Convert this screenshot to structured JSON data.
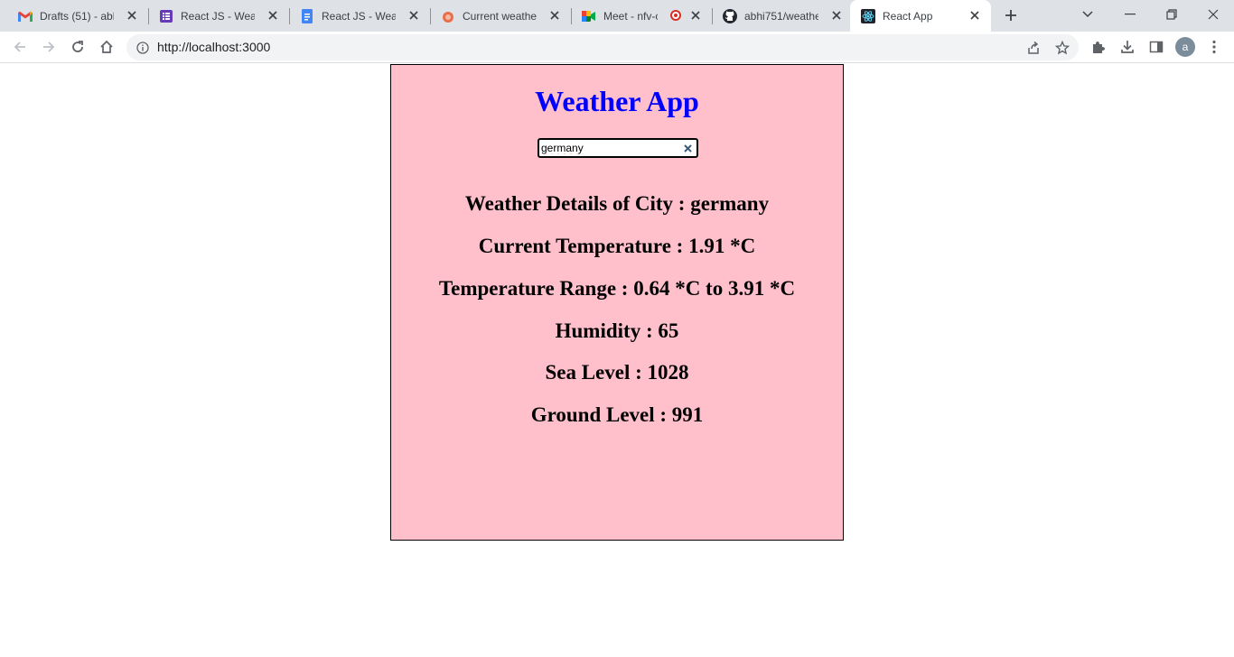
{
  "browser": {
    "tabs": [
      {
        "title": "Drafts (51) - abhi",
        "icon": "gmail-icon"
      },
      {
        "title": "React JS - Weathe",
        "icon": "forms-icon"
      },
      {
        "title": "React JS - Weathe",
        "icon": "docs-icon"
      },
      {
        "title": "Current weather",
        "icon": "openweather-icon"
      },
      {
        "title": "Meet - nfv-cy",
        "icon": "meet-icon",
        "recording": true
      },
      {
        "title": "abhi751/weather",
        "icon": "github-icon"
      },
      {
        "title": "React App",
        "icon": "react-icon",
        "active": true
      }
    ],
    "address": {
      "url": "http://localhost:3000"
    },
    "profile_initial": "a"
  },
  "app": {
    "title": "Weather App",
    "search": {
      "value": "germany"
    },
    "details": {
      "city": "Weather Details of City : germany",
      "current_temp": "Current Temperature : 1.91  *C",
      "temp_range": "Temperature Range : 0.64  *C to 3.91  *C",
      "humidity": "Humidity : 65",
      "sea_level": "Sea Level : 1028",
      "ground_level": "Ground Level : 991"
    },
    "colors": {
      "background": "#ffc0cb",
      "title": "#0000ff"
    }
  }
}
